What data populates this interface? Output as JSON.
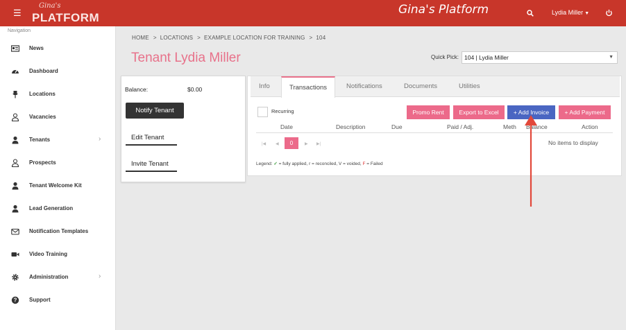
{
  "header": {
    "logo_script": "Gina's",
    "logo_word": "PLATFORM",
    "app_title": "Gina's Platform",
    "user_name": "Lydia Miller",
    "accent_color": "#c8362a"
  },
  "sidebar": {
    "heading": "Navigation",
    "items": [
      {
        "label": "News",
        "icon": "newspaper-icon"
      },
      {
        "label": "Dashboard",
        "icon": "dashboard-icon"
      },
      {
        "label": "Locations",
        "icon": "pin-icon"
      },
      {
        "label": "Vacancies",
        "icon": "user-outline-icon"
      },
      {
        "label": "Tenants",
        "icon": "user-icon",
        "expandable": true
      },
      {
        "label": "Prospects",
        "icon": "user-outline-icon"
      },
      {
        "label": "Tenant Welcome Kit",
        "icon": "user-icon"
      },
      {
        "label": "Lead Generation",
        "icon": "user-icon"
      },
      {
        "label": "Notification Templates",
        "icon": "envelope-icon"
      },
      {
        "label": "Video Training",
        "icon": "video-icon"
      },
      {
        "label": "Administration",
        "icon": "gear-icon",
        "expandable": true
      },
      {
        "label": "Support",
        "icon": "question-icon"
      }
    ]
  },
  "breadcrumb": {
    "items": [
      "HOME",
      "LOCATIONS",
      "EXAMPLE LOCATION FOR TRAINING",
      "104"
    ]
  },
  "page": {
    "title": "Tenant Lydia Miller",
    "title_color": "#e8718a"
  },
  "quick_pick": {
    "label": "Quick Pick:",
    "value": "104 | Lydia Miller"
  },
  "tenant_card": {
    "balance_label": "Balance:",
    "balance_value": "$0.00",
    "notify_button": "Notify Tenant",
    "edit_button": "Edit Tenant",
    "invite_button": "Invite Tenant"
  },
  "tabs": [
    "Info",
    "Transactions",
    "Notifications",
    "Documents",
    "Utilities"
  ],
  "active_tab": "Transactions",
  "transactions": {
    "recurring_label": "Recurring",
    "buttons": {
      "promo_rent": "Promo Rent",
      "export_excel": "Export to Excel",
      "add_invoice": "+ Add Invoice",
      "add_payment": "+ Add Payment"
    },
    "columns": [
      "Date",
      "Description",
      "Due",
      "Paid / Adj.",
      "Meth",
      "Balance",
      "Action"
    ],
    "pager": {
      "first": "|◀",
      "prev": "◀",
      "current_page": "0",
      "next": "▶",
      "last": "▶|"
    },
    "empty_text": "No items to display",
    "legend": {
      "prefix": "Legend:",
      "applied": "= fully applied, r = reconciled, V = voided,",
      "failed_letter": "F",
      "failed_text": "= Failed"
    }
  },
  "colors": {
    "pink_button": "#ec6a8a",
    "blue_button": "#4a66c2",
    "annotation_arrow": "#e2483a"
  }
}
